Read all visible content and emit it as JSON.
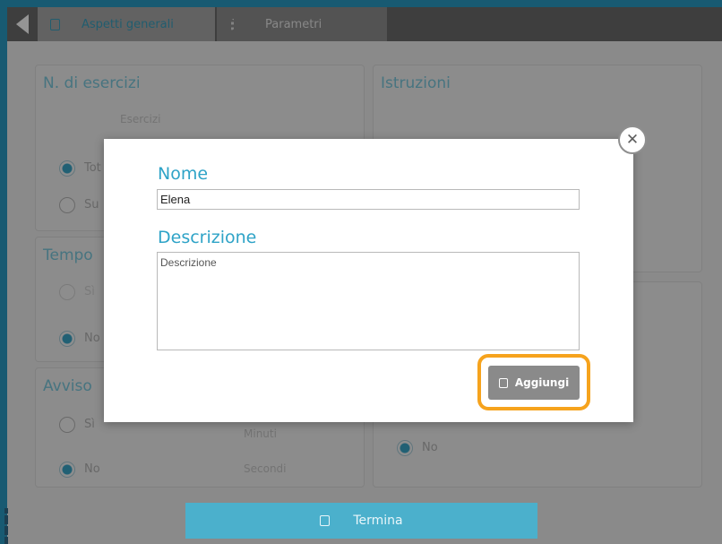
{
  "tabs": [
    {
      "label": "Aspetti generali"
    },
    {
      "label": "Parametri"
    }
  ],
  "panels": {
    "esercizi": {
      "title": "N. di esercizi",
      "sublabel": "Esercizi",
      "options": [
        "Tot",
        "Su"
      ]
    },
    "istruzioni": {
      "title": "Istruzioni"
    },
    "tempo": {
      "title": "Tempo",
      "options": [
        "Sì",
        "No"
      ]
    },
    "avviso": {
      "title": "Avviso",
      "options": [
        "Sì",
        "No"
      ],
      "fields": [
        "Minuti",
        "Secondi"
      ]
    },
    "right_bottom": {
      "options": [
        "No"
      ]
    }
  },
  "footer": {
    "termina_label": "Termina"
  },
  "modal": {
    "name_label": "Nome",
    "name_value": "Elena",
    "description_label": "Descrizione",
    "description_placeholder": "Descrizione",
    "add_label": "Aggiungi"
  },
  "colors": {
    "accent": "#2ea3c7",
    "highlight": "#f6a31d",
    "frame": "#2a9cc4"
  }
}
